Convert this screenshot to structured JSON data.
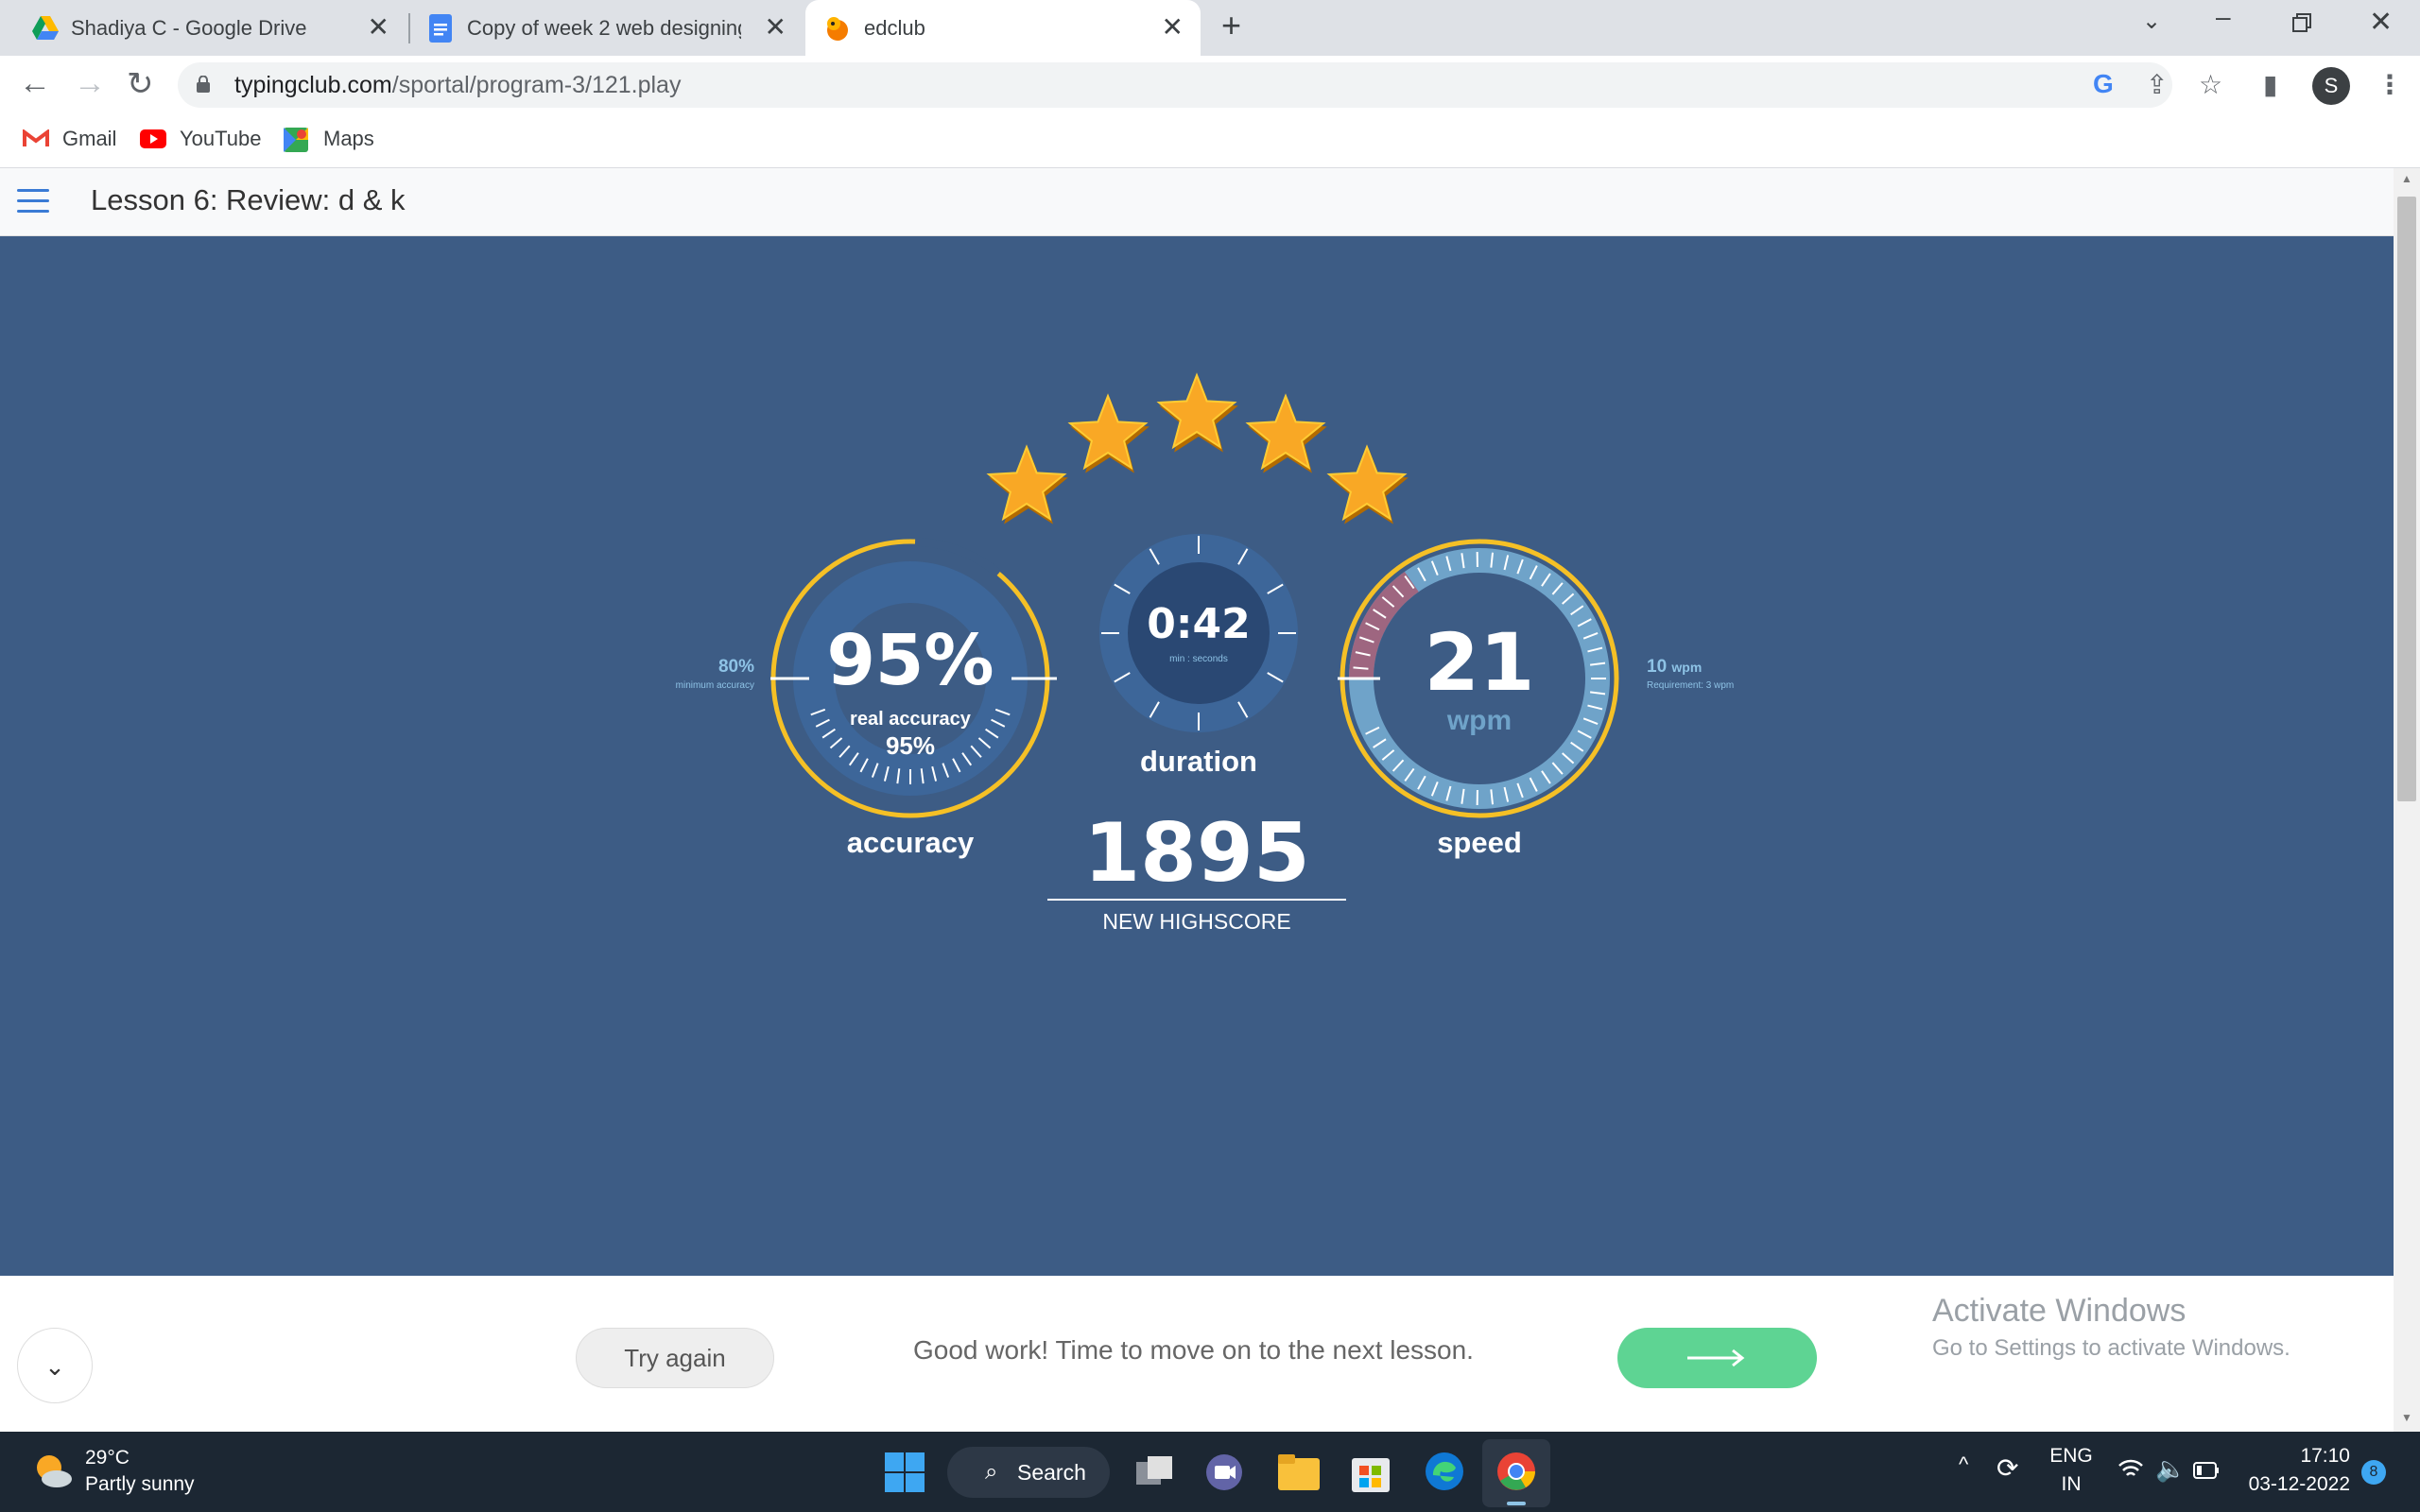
{
  "browser": {
    "tabs": [
      {
        "title": "Shadiya C - Google Drive",
        "icon": "google-drive-icon"
      },
      {
        "title": "Copy of week 2 web designing -",
        "icon": "google-docs-icon"
      },
      {
        "title": "edclub",
        "icon": "edclub-icon",
        "active": true
      }
    ],
    "url_host": "typingclub.com",
    "url_path": "/sportal/program-3/121.play",
    "avatar_letter": "S",
    "bookmarks": [
      "Gmail",
      "YouTube",
      "Maps"
    ]
  },
  "lesson": {
    "title": "Lesson 6: Review: d & k"
  },
  "results": {
    "stars_earned": 5,
    "stars_total": 5,
    "accuracy": {
      "value": "95%",
      "real_label": "real accuracy",
      "real_value": "95%",
      "label": "accuracy",
      "min_value": "80%",
      "min_label": "minimum accuracy",
      "level": 0.95
    },
    "duration": {
      "value": "0:42",
      "unit": "min : seconds",
      "label": "duration"
    },
    "speed": {
      "value": "21",
      "unit": "wpm",
      "label": "speed",
      "req_value": "10",
      "req_unit": "wpm",
      "req_label": "Requirement: 3 wpm"
    },
    "score": {
      "value": "1895",
      "label": "NEW HIGHSCORE"
    }
  },
  "bottom": {
    "try_again": "Try again",
    "message": "Good work! Time to move on to the next lesson.",
    "activate_title": "Activate Windows",
    "activate_sub": "Go to Settings to activate Windows."
  },
  "taskbar": {
    "temperature": "29°C",
    "weather": "Partly sunny",
    "search": "Search",
    "lang_top": "ENG",
    "lang_bottom": "IN",
    "time": "17:10",
    "date": "03-12-2022",
    "notifications": "8"
  },
  "colors": {
    "background": "#3d5c85",
    "gauge_ring": "#f5c026",
    "star": "#f9a825",
    "next_button": "#5ed493"
  }
}
